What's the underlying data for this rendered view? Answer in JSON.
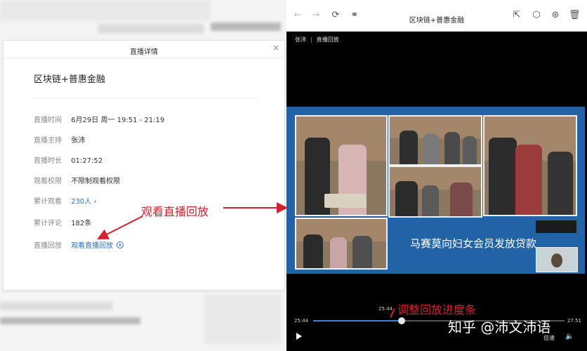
{
  "panel": {
    "title": "直播详情",
    "close_icon": "×",
    "event_title": "区块链+普惠金融",
    "rows": [
      {
        "label": "直播时间",
        "value": "6月29日 周一 19:51 - 21:19"
      },
      {
        "label": "直播主持",
        "value": "张沛"
      },
      {
        "label": "直播时长",
        "value": "01:27:52"
      },
      {
        "label": "观看权限",
        "value": "不限制观看权限"
      },
      {
        "label": "累计观看",
        "value": "230人 ›"
      },
      {
        "label": "累计评论",
        "value": "182条"
      },
      {
        "label": "直播回放",
        "value": "观看直播回放"
      }
    ]
  },
  "annotations": {
    "watch_replay": "观看直播回放",
    "adjust_progress": "调整回放进度条"
  },
  "browser": {
    "title": "区块链+普惠金融",
    "icons": [
      "back-arrow-icon",
      "forward-arrow-icon",
      "refresh-icon",
      "link-icon",
      "share-icon",
      "box-icon",
      "pin-icon",
      "trash-icon"
    ],
    "icon_glyphs": {
      "back": "←",
      "forward": "→",
      "refresh": "⟳",
      "link": "⚭",
      "share": "⇱",
      "box": "⬡",
      "pin": "⊛",
      "trash": "🗑"
    }
  },
  "player": {
    "breadcrumb": {
      "host": "张沛",
      "section": "直播回放"
    },
    "slide_caption": "马赛莫向妇女会员发放贷款",
    "time_tooltip": "25:44",
    "time_current": "25:44",
    "time_total": "27:51",
    "progress_fraction": 0.352,
    "speed_label": "倍速",
    "volume_icon": "🔈",
    "watermark": "知乎 @沛文沛语"
  },
  "colors": {
    "annotation": "#d6202b",
    "link": "#2a72c9",
    "slide_bg": "#2262a6",
    "progress": "#3b82e0"
  }
}
